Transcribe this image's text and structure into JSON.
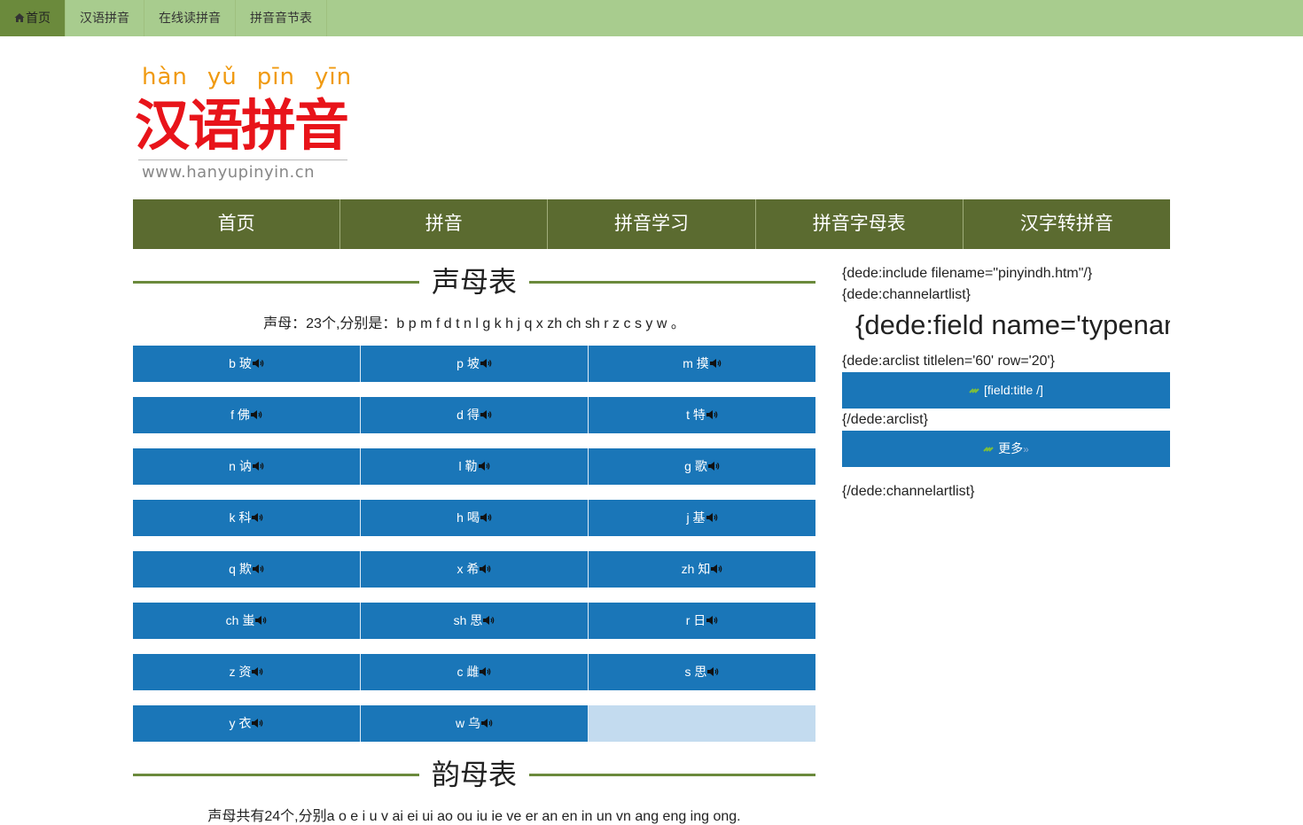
{
  "topbar": {
    "items": [
      "首页",
      "汉语拼音",
      "在线读拼音",
      "拼音音节表"
    ]
  },
  "logo": {
    "pinyin": [
      "hàn",
      "yǔ",
      "pīn",
      "yīn"
    ],
    "title": "汉语拼音",
    "url": "www.hanyupinyin.cn"
  },
  "mainnav": {
    "items": [
      "首页",
      "拼音",
      "拼音学习",
      "拼音字母表",
      "汉字转拼音"
    ]
  },
  "shengmu": {
    "title": "声母表",
    "desc": "声母：23个,分别是：b p m f d t n l g k h j q x zh ch sh r z c s y w 。",
    "cells": [
      [
        "b 玻",
        "p 坡",
        "m 摸"
      ],
      [
        "f 佛",
        "d 得",
        "t 特"
      ],
      [
        "n 讷",
        "l 勒",
        "g 歌"
      ],
      [
        "k 科",
        "h 喝",
        "j 基"
      ],
      [
        "q 欺",
        "x 希",
        "zh 知"
      ],
      [
        "ch 蚩",
        "sh 思",
        "r 日"
      ],
      [
        "z 资",
        "c 雌",
        "s 思"
      ],
      [
        "y 衣",
        "w 乌"
      ]
    ]
  },
  "yunmu": {
    "title": "韵母表",
    "desc": "声母共有24个,分别a o e i u v ai ei ui ao ou iu ie ve er an en in un vn ang eng ing ong."
  },
  "side": {
    "include": "{dede:include filename=\"pinyindh.htm\"/}",
    "channelartlist_open": "{dede:channelartlist}",
    "field_typename": "{dede:field name='typename'/}",
    "arclist_open": "{dede:arclist titlelen='60' row='20'}",
    "field_title": "[field:title /]",
    "arclist_close": "{/dede:arclist}",
    "more": "更多",
    "channelartlist_close": "{/dede:channelartlist}"
  },
  "colors": {
    "topbar": "#a8cc8e",
    "nav": "#5b6b30",
    "cell": "#1a76b8",
    "cell_empty": "#c3dbef",
    "logo_red": "#e8141a",
    "logo_orange": "#f09a10"
  },
  "icons": {
    "home": "home-icon",
    "speaker": "speaker-icon",
    "link": "link-icon"
  }
}
